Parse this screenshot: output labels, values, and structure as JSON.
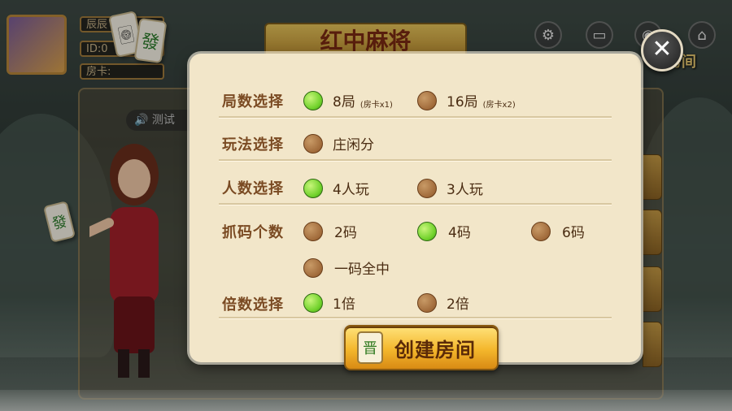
{
  "background": {
    "title_plaque": "红中麻将",
    "room_label": "房间",
    "test_label": "测试",
    "profile": {
      "nickname": "辰辰",
      "id_label": "ID:0",
      "card_label": "房卡:"
    },
    "tile_glyph_left": "🀙",
    "tile_glyph_right": "發",
    "character_tile": "發"
  },
  "icons": {
    "settings": "gear-icon",
    "video": "camera-icon",
    "message": "chat-icon",
    "home": "home-icon",
    "close": "close-icon"
  },
  "dialog": {
    "rows": [
      {
        "key": "rounds",
        "label": "局数选择",
        "options": [
          {
            "text": "8局",
            "note": "(房卡x1)",
            "selected": true
          },
          {
            "text": "16局",
            "note": "(房卡x2)",
            "selected": false
          }
        ]
      },
      {
        "key": "mode",
        "label": "玩法选择",
        "options": [
          {
            "text": "庄闲分",
            "selected": false
          }
        ]
      },
      {
        "key": "players",
        "label": "人数选择",
        "options": [
          {
            "text": "4人玩",
            "selected": true
          },
          {
            "text": "3人玩",
            "selected": false
          }
        ]
      },
      {
        "key": "codes",
        "label": "抓码个数",
        "options": [
          {
            "text": "2码",
            "selected": false
          },
          {
            "text": "4码",
            "selected": true
          },
          {
            "text": "6码",
            "selected": false
          },
          {
            "text": "一码全中",
            "selected": false
          }
        ]
      },
      {
        "key": "multiplier",
        "label": "倍数选择",
        "options": [
          {
            "text": "1倍",
            "selected": true
          },
          {
            "text": "2倍",
            "selected": false
          }
        ]
      }
    ],
    "create_button": "创建房间",
    "create_tile": "晋"
  },
  "colors": {
    "selected_radio": "#6fd12a",
    "unselected_radio": "#a06a3a",
    "dialog_bg": "#f2e6c9",
    "label": "#7a4a22",
    "button": "#f4b72c"
  }
}
